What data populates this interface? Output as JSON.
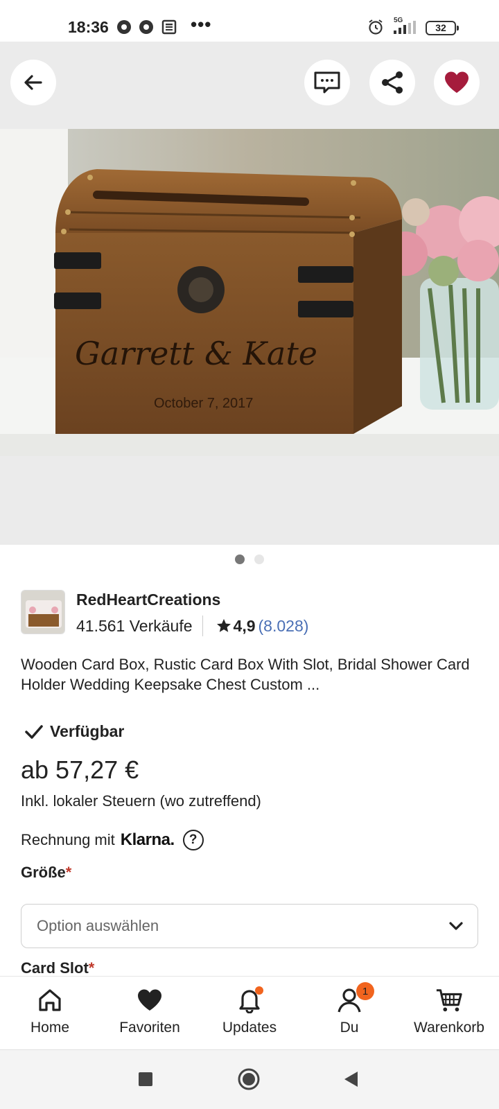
{
  "status_bar": {
    "time": "18:36",
    "network": "5G",
    "battery": "32",
    "more": "•••"
  },
  "product_image": {
    "engraving_names": "Garrett & Kate",
    "engraving_date": "October 7, 2017",
    "carousel_count": 2,
    "carousel_active": 0
  },
  "shop": {
    "name": "RedHeartCreations",
    "sales": "41.561 Verkäufe",
    "rating": "4,9",
    "review_count": "(8.028)"
  },
  "listing": {
    "title": "Wooden Card Box, Rustic Card Box With Slot, Bridal Shower Card Holder Wedding Keepsake Chest Custom ...",
    "availability": "Verfügbar",
    "price": "ab 57,27 €",
    "tax_note": "Inkl. lokaler Steuern (wo zutreffend)",
    "klarna_text": "Rechnung mit",
    "klarna_brand": "Klarna.",
    "help_symbol": "?"
  },
  "options": {
    "size_label": "Größe",
    "size_placeholder": "Option auswählen",
    "card_slot_label": "Card Slot",
    "required_mark": "*"
  },
  "bottom_nav": {
    "home": "Home",
    "favorites": "Favoriten",
    "updates": "Updates",
    "you": "Du",
    "you_badge": "1",
    "cart": "Warenkorb"
  },
  "colors": {
    "accent": "#f1641e",
    "heart": "#a51c3c",
    "link": "#4a6fb5"
  }
}
